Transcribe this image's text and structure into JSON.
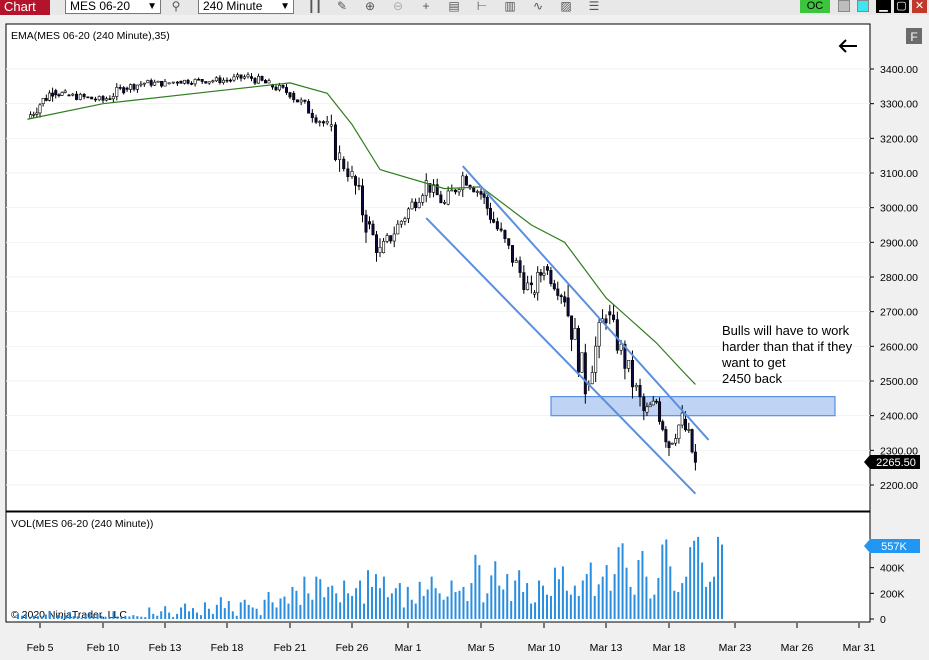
{
  "window": {
    "title": "Chart",
    "instrument": "MES 06-20",
    "interval": "240 Minute",
    "oc_label": "OC",
    "f_label": "F"
  },
  "price_panel": {
    "indicator_label": "EMA(MES 06-20 (240 Minute),35)",
    "current_price_label": "2265.50",
    "annotation": [
      "Bulls will have to work",
      "harder than that if they",
      "want to get",
      "2450 back"
    ]
  },
  "volume_panel": {
    "indicator_label": "VOL(MES 06-20 (240 Minute))",
    "current_volume_label": "557K",
    "copyright": "© 2020 NinjaTrader, LLC"
  },
  "colors": {
    "accent_title": "#b3142b",
    "ema_line": "#2e7d1e",
    "channel": "#5b8fe0",
    "volume_bar": "#2a8ee0",
    "zone_fill": "#a9c6f2",
    "badge_blue": "#2196f3"
  },
  "chart_data": [
    {
      "type": "candlestick",
      "title": "",
      "xlabel": "",
      "ylabel": "",
      "ylim": [
        2150,
        3480
      ],
      "y_ticks": [
        "3400.00",
        "3300.00",
        "3200.00",
        "3100.00",
        "3000.00",
        "2900.00",
        "2800.00",
        "2700.00",
        "2600.00",
        "2500.00",
        "2400.00",
        "2300.00",
        "2200.00"
      ],
      "x_ticks": [
        "Feb 5",
        "Feb 10",
        "Feb 13",
        "Feb 18",
        "Feb 21",
        "Feb 26",
        "Mar 1",
        "Mar 5",
        "Mar 10",
        "Mar 13",
        "Mar 18",
        "Mar 23",
        "Mar 26",
        "Mar 31"
      ],
      "close_series": [
        [
          "Feb 4",
          3258
        ],
        [
          "Feb 5",
          3300
        ],
        [
          "Feb 6",
          3338
        ],
        [
          "Feb 7",
          3325
        ],
        [
          "Feb 10",
          3310
        ],
        [
          "Feb 11",
          3345
        ],
        [
          "Feb 12",
          3360
        ],
        [
          "Feb 13",
          3358
        ],
        [
          "Feb 14",
          3365
        ],
        [
          "Feb 18",
          3368
        ],
        [
          "Feb 19",
          3378
        ],
        [
          "Feb 20",
          3355
        ],
        [
          "Feb 21",
          3330
        ],
        [
          "Feb 24",
          3235
        ],
        [
          "Feb 25",
          3140
        ],
        [
          "Feb 26",
          3090
        ],
        [
          "Feb 27",
          2960
        ],
        [
          "Feb 28",
          2870
        ],
        [
          "Mar 2",
          3070
        ],
        [
          "Mar 3",
          3010
        ],
        [
          "Mar 4",
          3090
        ],
        [
          "Mar 5",
          3040
        ],
        [
          "Mar 6",
          2960
        ],
        [
          "Mar 9",
          2750
        ],
        [
          "Mar 10",
          2830
        ],
        [
          "Mar 11",
          2740
        ],
        [
          "Mar 12",
          2490
        ],
        [
          "Mar 13",
          2700
        ],
        [
          "Mar 16",
          2410
        ],
        [
          "Mar 17",
          2440
        ],
        [
          "Mar 18",
          2320
        ],
        [
          "Mar 19",
          2390
        ],
        [
          "Mar 20",
          2265.5
        ]
      ],
      "ema_series": [
        [
          "Feb 4",
          3255
        ],
        [
          "Feb 10",
          3300
        ],
        [
          "Feb 18",
          3340
        ],
        [
          "Feb 21",
          3360
        ],
        [
          "Feb 24",
          3330
        ],
        [
          "Feb 26",
          3240
        ],
        [
          "Feb 28",
          3110
        ],
        [
          "Mar 3",
          3055
        ],
        [
          "Mar 5",
          3060
        ],
        [
          "Mar 9",
          2950
        ],
        [
          "Mar 11",
          2900
        ],
        [
          "Mar 13",
          2740
        ],
        [
          "Mar 17",
          2610
        ],
        [
          "Mar 19",
          2530
        ],
        [
          "Mar 20",
          2490
        ]
      ],
      "zone": [
        2400,
        2455
      ],
      "channel_upper": [
        [
          "Mar 4",
          3120
        ],
        [
          "Mar 21",
          2330
        ]
      ],
      "channel_lower": [
        [
          "Mar 2",
          2970
        ],
        [
          "Mar 20",
          2175
        ]
      ]
    },
    {
      "type": "bar",
      "title": "",
      "ylim": [
        0,
        700
      ],
      "y_ticks": [
        "400K",
        "200K",
        "0"
      ],
      "unit": "K contracts",
      "values": [
        40,
        25,
        35,
        10,
        25,
        22,
        20,
        35,
        60,
        20,
        30,
        25,
        28,
        55,
        22,
        20,
        10,
        30,
        55,
        18,
        40,
        25,
        18,
        12,
        60,
        20,
        15,
        25,
        20,
        30,
        22,
        18,
        15,
        90,
        40,
        25,
        60,
        100,
        50,
        15,
        40,
        90,
        120,
        60,
        85,
        50,
        30,
        130,
        80,
        40,
        110,
        170,
        85,
        140,
        60,
        25,
        130,
        150,
        110,
        90,
        80,
        30,
        150,
        210,
        130,
        90,
        160,
        175,
        120,
        250,
        220,
        110,
        330,
        200,
        150,
        330,
        310,
        170,
        250,
        260,
        200,
        130,
        300,
        200,
        180,
        240,
        300,
        120,
        380,
        250,
        350,
        240,
        330,
        170,
        200,
        240,
        280,
        90,
        250,
        150,
        120,
        290,
        180,
        230,
        330,
        240,
        200,
        150,
        175,
        300,
        210,
        220,
        250,
        140,
        280,
        500,
        420,
        130,
        200,
        340,
        450,
        260,
        230,
        350,
        140,
        300,
        380,
        210,
        280,
        120,
        130,
        300,
        260,
        190,
        180,
        400,
        310,
        410,
        220,
        190,
        260,
        180,
        300,
        350,
        440,
        180,
        270,
        330,
        420,
        220,
        350,
        560,
        590,
        400,
        250,
        190,
        460,
        530,
        330,
        160,
        190,
        320,
        580,
        620,
        410,
        220,
        210,
        280,
        330,
        560,
        610,
        640,
        440,
        250,
        290,
        330,
        640,
        580
      ]
    }
  ]
}
